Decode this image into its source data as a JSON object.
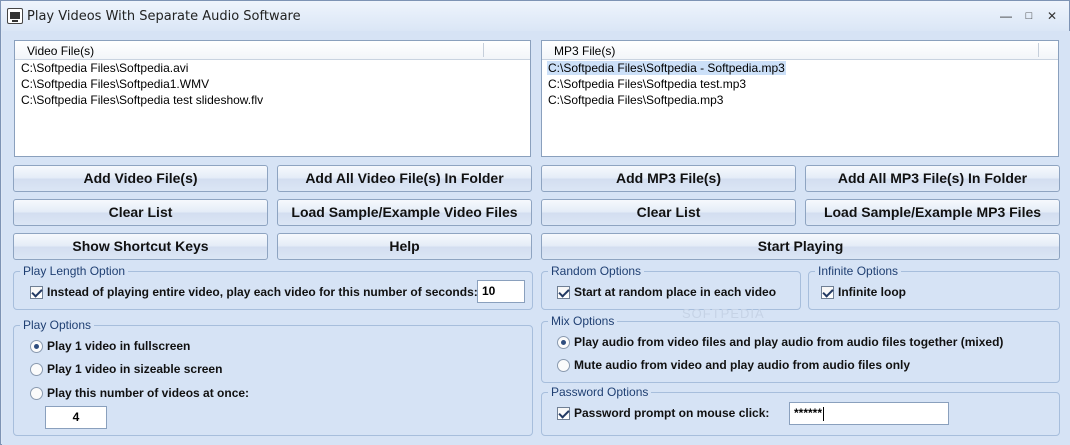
{
  "window": {
    "title": "Play Videos With Separate Audio Software",
    "minimize": "―",
    "maximize": "□",
    "close": "✕"
  },
  "video_list": {
    "header": "Video File(s)",
    "items": [
      "C:\\Softpedia Files\\Softpedia.avi",
      "C:\\Softpedia Files\\Softpedia1.WMV",
      "C:\\Softpedia Files\\Softpedia test slideshow.flv"
    ]
  },
  "mp3_list": {
    "header": "MP3 File(s)",
    "items": [
      "C:\\Softpedia Files\\Softpedia - Softpedia.mp3",
      "C:\\Softpedia Files\\Softpedia test.mp3",
      "C:\\Softpedia Files\\Softpedia.mp3"
    ],
    "selected_index": 0
  },
  "buttons": {
    "add_video": "Add Video File(s)",
    "add_all_video": "Add All Video File(s) In Folder",
    "add_mp3": "Add MP3 File(s)",
    "add_all_mp3": "Add All MP3 File(s) In Folder",
    "clear_video": "Clear List",
    "load_sample_video": "Load Sample/Example Video Files",
    "clear_mp3": "Clear List",
    "load_sample_mp3": "Load Sample/Example MP3 Files",
    "shortcut_keys": "Show Shortcut Keys",
    "help": "Help",
    "start_playing": "Start Playing"
  },
  "play_length": {
    "title": "Play Length Option",
    "checkbox_label": "Instead of playing entire video, play each video for this number of seconds:",
    "checked": true,
    "seconds": "10"
  },
  "play_options": {
    "title": "Play Options",
    "options": [
      "Play 1 video in fullscreen",
      "Play 1 video in sizeable screen",
      "Play this number of videos at once:"
    ],
    "selected_index": 0,
    "count": "4"
  },
  "random_options": {
    "title": "Random Options",
    "checkbox_label": "Start at random place in each video",
    "checked": true
  },
  "infinite_options": {
    "title": "Infinite Options",
    "checkbox_label": "Infinite loop",
    "checked": true
  },
  "mix_options": {
    "title": "Mix Options",
    "options": [
      "Play audio from video files and play audio from audio files together (mixed)",
      "Mute audio from video and play audio from audio files only"
    ],
    "selected_index": 0
  },
  "password_options": {
    "title": "Password Options",
    "checkbox_label": "Password prompt on mouse click:",
    "checked": true,
    "value": "******"
  },
  "watermark": "SOFTPEDIA"
}
